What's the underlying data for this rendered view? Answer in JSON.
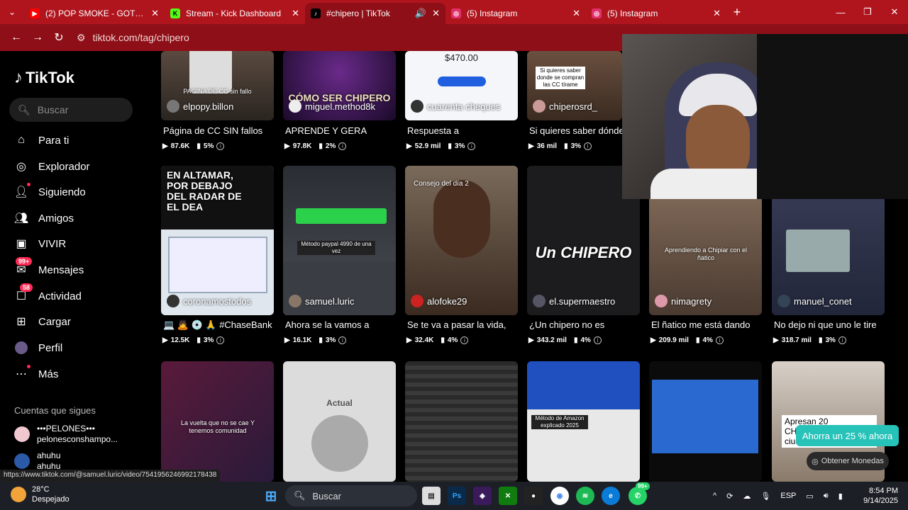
{
  "browser": {
    "tabs": [
      {
        "title": "(2) POP SMOKE - GOT IT ON ME",
        "favicon": "youtube-icon",
        "color": "#ff0000"
      },
      {
        "title": "Stream - Kick Dashboard",
        "favicon": "kick-icon",
        "color": "#53fc18"
      },
      {
        "title": "#chipero | TikTok",
        "favicon": "tiktok-icon",
        "color": "#000000",
        "active": true
      },
      {
        "title": "(5) Instagram",
        "favicon": "instagram-icon",
        "color": "#e1306c"
      },
      {
        "title": "(5) Instagram",
        "favicon": "instagram-icon",
        "color": "#e1306c"
      }
    ],
    "url": "tiktok.com/tag/chipero",
    "accent": "#b0151e"
  },
  "tiktok": {
    "logo": "TikTok",
    "search_placeholder": "Buscar",
    "nav": [
      {
        "label": "Para ti",
        "icon": "home-icon"
      },
      {
        "label": "Explorador",
        "icon": "compass-icon"
      },
      {
        "label": "Siguiendo",
        "icon": "following-icon"
      },
      {
        "label": "Amigos",
        "icon": "friends-icon"
      },
      {
        "label": "VIVIR",
        "icon": "live-icon"
      },
      {
        "label": "Mensajes",
        "icon": "messages-icon",
        "badge": "99+"
      },
      {
        "label": "Actividad",
        "icon": "activity-icon",
        "badge": "58"
      },
      {
        "label": "Cargar",
        "icon": "upload-icon"
      },
      {
        "label": "Perfil",
        "icon": "profile-icon"
      },
      {
        "label": "Más",
        "icon": "more-icon"
      }
    ],
    "following_header": "Cuentas que sigues",
    "following": [
      {
        "name": "•••PELONES•••",
        "handle": "pelonesconshampo..."
      },
      {
        "name": "ahuhu",
        "handle": "ahuhu"
      }
    ]
  },
  "videos_row1": [
    {
      "user": "elpopy.billon",
      "desc": "Página de CC SIN fallos",
      "views": "87.6K",
      "pct": "5%",
      "overlay": "PAGINA DE CC sin fallo"
    },
    {
      "user": "miguel.method8k",
      "desc": "APRENDE Y GERA",
      "views": "97.8K",
      "pct": "2%",
      "overlay": "CÓMO SER CHIPERO"
    },
    {
      "user": "cuarenta cheques",
      "desc": "Respuesta a",
      "views": "52.9 mil",
      "pct": "3%",
      "overlay": "$470.00"
    },
    {
      "user": "chiperosrd_",
      "desc": "Si quieres saber dónde",
      "views": "36 mil",
      "pct": "3%",
      "overlay": "Si quieres saber donde se compran las CC tírame"
    }
  ],
  "videos_row2": [
    {
      "user": "coronamostodos",
      "desc": "💻 🙇 💿 🙏 #ChaseBank",
      "views": "12.5K",
      "pct": "3%",
      "overlay": "EN ALTAMAR, POR DEBAJO DEL RADAR DE EL DEA"
    },
    {
      "user": "samuel.luric",
      "desc": "Ahora se la vamos a",
      "views": "16.1K",
      "pct": "3%",
      "overlay": "Método paypal 4990 de una vez"
    },
    {
      "user": "alofoke29",
      "desc": "Se te va a pasar la vida,",
      "views": "32.4K",
      "pct": "4%",
      "overlay": "Consejo del día 2"
    },
    {
      "user": "el.supermaestro",
      "desc": "¿Un chipero no es",
      "views": "343.2 mil",
      "pct": "4%",
      "overlay": "Un CHIPERO"
    },
    {
      "user": "nimagrety",
      "desc": "El ñatico me está dando",
      "views": "209.9 mil",
      "pct": "4%",
      "overlay": "Aprendiendo a Chipiar con el ñatico"
    },
    {
      "user": "manuel_conet",
      "desc": "No dejo ni que uno le tire",
      "views": "318.7 mil",
      "pct": "3%",
      "overlay": ""
    }
  ],
  "videos_row3": [
    {
      "overlay": "La vuelta que no se cae Y tenemos comunidad"
    },
    {
      "overlay": "Actual"
    },
    {
      "overlay": ""
    },
    {
      "overlay": "Método de Amazon explicado 2025"
    },
    {
      "overlay": ""
    },
    {
      "overlay": "Apresan 20 CHIPEROS en ciudadanos de USA"
    }
  ],
  "promo": {
    "text": "Ahorra un 25 % ahora",
    "coins": "Obtener Monedas"
  },
  "status_url": "https://www.tiktok.com/@samuel.luric/video/7541956246992178438",
  "taskbar": {
    "temp": "28°C",
    "weather": "Despejado",
    "search": "Buscar",
    "lang": "ESP",
    "time": "8:54 PM",
    "date": "9/14/2025",
    "badge": "99+"
  }
}
